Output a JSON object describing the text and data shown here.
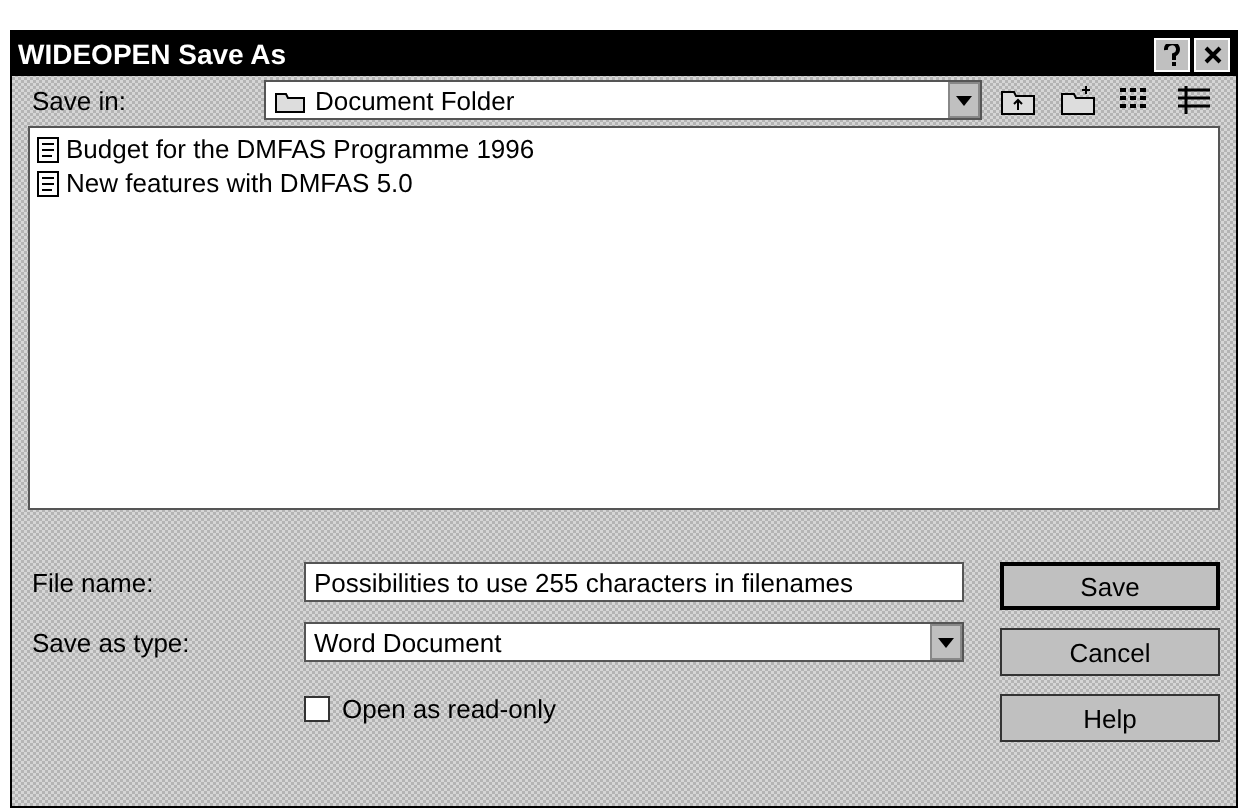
{
  "window": {
    "title": "WIDEOPEN Save As"
  },
  "save_in": {
    "label": "Save in:",
    "value": "Document Folder"
  },
  "files": [
    {
      "name": "Budget for the DMFAS Programme 1996",
      "selected": false
    },
    {
      "name": "New features with DMFAS 5.0",
      "selected": false
    }
  ],
  "file_name": {
    "label": "File name:",
    "value": "Possibilities to use 255 characters in filenames"
  },
  "save_as_type": {
    "label": "Save as type:",
    "value": "Word Document"
  },
  "read_only": {
    "label": "Open as read-only",
    "checked": false
  },
  "buttons": [
    {
      "label": "Save",
      "kind": "default"
    },
    {
      "label": "Cancel",
      "kind": "normal"
    },
    {
      "label": "Help",
      "kind": "normal"
    }
  ]
}
